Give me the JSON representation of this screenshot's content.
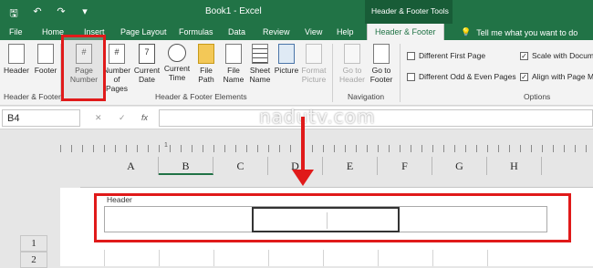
{
  "window": {
    "title": "Book1 - Excel",
    "context_band": "Header & Footer Tools"
  },
  "qat": {
    "save": "🖫",
    "undo": "↶",
    "redo": "↷",
    "customize": "▾"
  },
  "tabs": [
    "File",
    "Home",
    "Insert",
    "Page Layout",
    "Formulas",
    "Data",
    "Review",
    "View",
    "Help"
  ],
  "active_tab": "Header & Footer",
  "tell_me": "Tell me what you want to do",
  "ribbon": {
    "header_label": "Header",
    "footer_label": "Footer",
    "page_number_label": "Page Number",
    "number_of_pages_label": "Number of Pages",
    "current_date_label": "Current Date",
    "current_time_label": "Current Time",
    "file_path_label": "File Path",
    "file_name_label": "File Name",
    "sheet_name_label": "Sheet Name",
    "picture_label": "Picture",
    "format_picture_label": "Format Picture",
    "goto_header_label": "Go to Header",
    "goto_footer_label": "Go to Footer",
    "groups": {
      "header_footer": "Header & Footer",
      "elements": "Header & Footer Elements",
      "navigation": "Navigation",
      "options": "Options"
    },
    "options": {
      "different_first_page": "Different First Page",
      "different_odd_even": "Different Odd & Even Pages",
      "scale_with_document": "Scale with Docum",
      "align_with_margins": "Align with Page M"
    }
  },
  "formula_bar": {
    "name_box": "B4",
    "cancel": "✕",
    "enter": "✓",
    "fx": "fx"
  },
  "watermark": "nadutv.com",
  "ruler_mark": "1",
  "columns": [
    "A",
    "B",
    "C",
    "D",
    "E",
    "F",
    "G",
    "H"
  ],
  "header_area_label": "Header",
  "rows": [
    "1",
    "2"
  ],
  "accent_color": "#217346",
  "highlight_color": "#e01a1a"
}
